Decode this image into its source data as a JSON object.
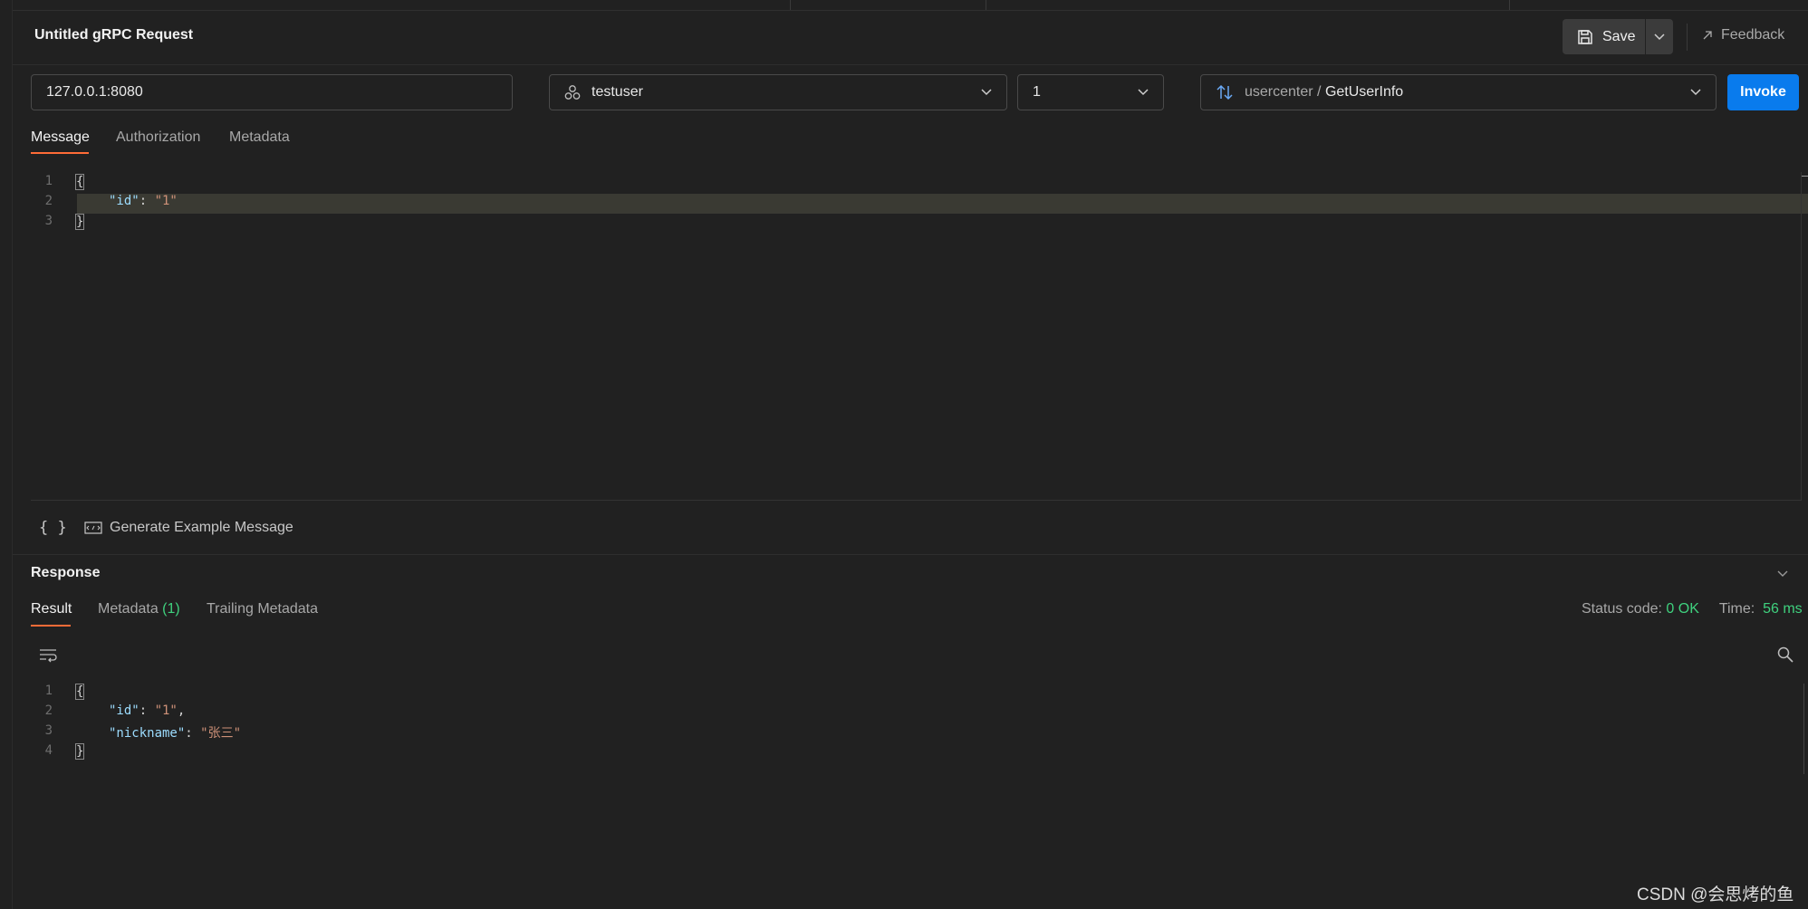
{
  "request": {
    "title": "Untitled gRPC Request",
    "save_label": "Save",
    "feedback_label": "Feedback",
    "url_value": "127.0.0.1:8080",
    "service_value": "testuser",
    "version_value": "1",
    "method_service": "usercenter",
    "method_separator": " / ",
    "method_name": "GetUserInfo",
    "invoke_label": "Invoke"
  },
  "request_tabs": [
    "Message",
    "Authorization",
    "Metadata"
  ],
  "message_code": {
    "line_numbers": [
      "1",
      "2",
      "3"
    ],
    "open_brace": "{",
    "close_brace": "}",
    "key_id": "\"id\"",
    "colon": ": ",
    "val_id": "\"1\""
  },
  "message_toolbar": {
    "braces_icon_text": "{ }",
    "generate_label": "Generate Example Message"
  },
  "response": {
    "title": "Response",
    "tabs": {
      "result": "Result",
      "metadata": "Metadata",
      "metadata_count": "(1)",
      "trailing": "Trailing Metadata"
    },
    "status_label": "Status code:",
    "status_value": "0 OK",
    "time_label": "Time:",
    "time_value": "56 ms",
    "code": {
      "line_numbers": [
        "1",
        "2",
        "3",
        "4"
      ],
      "open_brace": "{",
      "close_brace": "}",
      "key_id": "\"id\"",
      "val_id": "\"1\"",
      "comma": ",",
      "key_nickname": "\"nickname\"",
      "val_nickname": "\"张三\"",
      "colon": ": "
    }
  },
  "watermark": "CSDN @会思烤的鱼",
  "colors": {
    "accent_blue": "#097bed",
    "tab_underline": "#ff6c37",
    "status_green": "#3fd17e"
  }
}
